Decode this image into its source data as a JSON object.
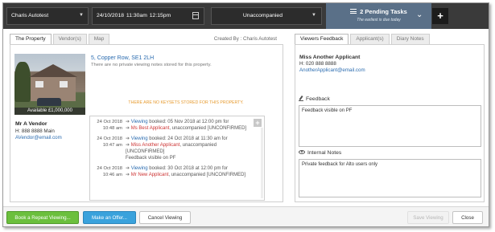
{
  "topbar": {
    "user": "Charis Autotest",
    "date": "24/10/2018",
    "start_time": "11:30am",
    "end_time": "12:15pm",
    "accompaniment": "Unaccompanied",
    "tasks_title": "2 Pending Tasks",
    "tasks_subtitle": "The earliest is due today",
    "add_label": "+"
  },
  "left_tabs": [
    {
      "label": "The Property",
      "active": true
    },
    {
      "label": "Vendor(s)",
      "active": false
    },
    {
      "label": "Map",
      "active": false
    }
  ],
  "created_by": "Created By : Charis Autotest",
  "property": {
    "price": "Available £1,000,000",
    "address": "5, Copper Row, SE1 2LH",
    "no_viewing_notes": "There are no private viewing notes stored for this property.",
    "no_keysets": "THERE ARE NO KEYSETS STORED FOR THIS PROPERTY."
  },
  "vendor": {
    "name": "Mr A Vendor",
    "phone": "H: 888 8888 Main",
    "email": "AVendor@email.com"
  },
  "activity": {
    "add_label": "+",
    "entries": [
      {
        "date": "24 Oct 2018",
        "time": "10:48 am",
        "link": "Viewing",
        "text1": " booked: 05 Nov 2018 at 12:00 pm for",
        "name": "Ms Best Applicant",
        "text2": ", unaccompanied [UNCONFIRMED]"
      },
      {
        "date": "24 Oct 2018",
        "time": "10:47 am",
        "link": "Viewing",
        "text1": " booked: 24 Oct 2018 at 11:30 am for",
        "name": "Miss Another Applicant",
        "text2": ", unaccompanied [UNCONFIRMED]",
        "extra": "Feedback visible on PF"
      },
      {
        "date": "24 Oct 2018",
        "time": "10:46 am",
        "link": "Viewing",
        "text1": " booked: 30 Oct 2018 at 12:00 pm for",
        "name": "Mr New Applicant",
        "text2": ", unaccompanied [UNCONFIRMED]"
      }
    ]
  },
  "right_tabs": [
    {
      "label": "Viewers Feedback",
      "active": true
    },
    {
      "label": "Applicant(s)",
      "active": false
    },
    {
      "label": "Diary Notes",
      "active": false
    }
  ],
  "applicant": {
    "name": "Miss Another Applicant",
    "phone": "H: 020 888 8888",
    "email": "AnotherApplicant@email.com"
  },
  "feedback": {
    "label": "Feedback",
    "value": "Feedback visible on PF"
  },
  "internal_notes": {
    "label": "Internal Notes",
    "value": "Private feedback for Alto users only"
  },
  "footer": {
    "repeat_label": "Book a Repeat Viewing...",
    "offer_label": "Make an Offer...",
    "cancel_label": "Cancel Viewing",
    "save_label": "Save Viewing",
    "close_label": "Close"
  }
}
